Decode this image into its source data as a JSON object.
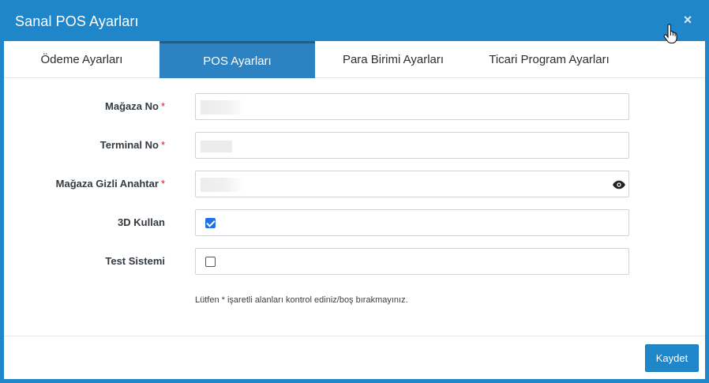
{
  "dialog": {
    "title": "Sanal POS Ayarları",
    "close_symbol": "×"
  },
  "tabs": [
    {
      "label": "Ödeme Ayarları",
      "active": false
    },
    {
      "label": "POS Ayarları",
      "active": true
    },
    {
      "label": "Para Birimi Ayarları",
      "active": false
    },
    {
      "label": "Ticari Program Ayarları",
      "active": false
    }
  ],
  "form": {
    "store_no": {
      "label": "Mağaza No",
      "required": "*",
      "value": ""
    },
    "terminal_no": {
      "label": "Terminal No",
      "required": "*",
      "value": ""
    },
    "store_secret_key": {
      "label": "Mağaza Gizli Anahtar",
      "required": "*",
      "value": "",
      "icon": "eye-icon"
    },
    "use_3d": {
      "label": "3D Kullan",
      "checked": true
    },
    "test_system": {
      "label": "Test Sistemi",
      "checked": false
    },
    "note": "Lütfen * işaretli alanları kontrol ediniz/boş bırakmayınız."
  },
  "footer": {
    "save_label": "Kaydet"
  },
  "colors": {
    "header": "#1f86c9",
    "active_tab": "#2d83c2",
    "required": "#d0212e",
    "checkbox": "#1a73e8"
  }
}
